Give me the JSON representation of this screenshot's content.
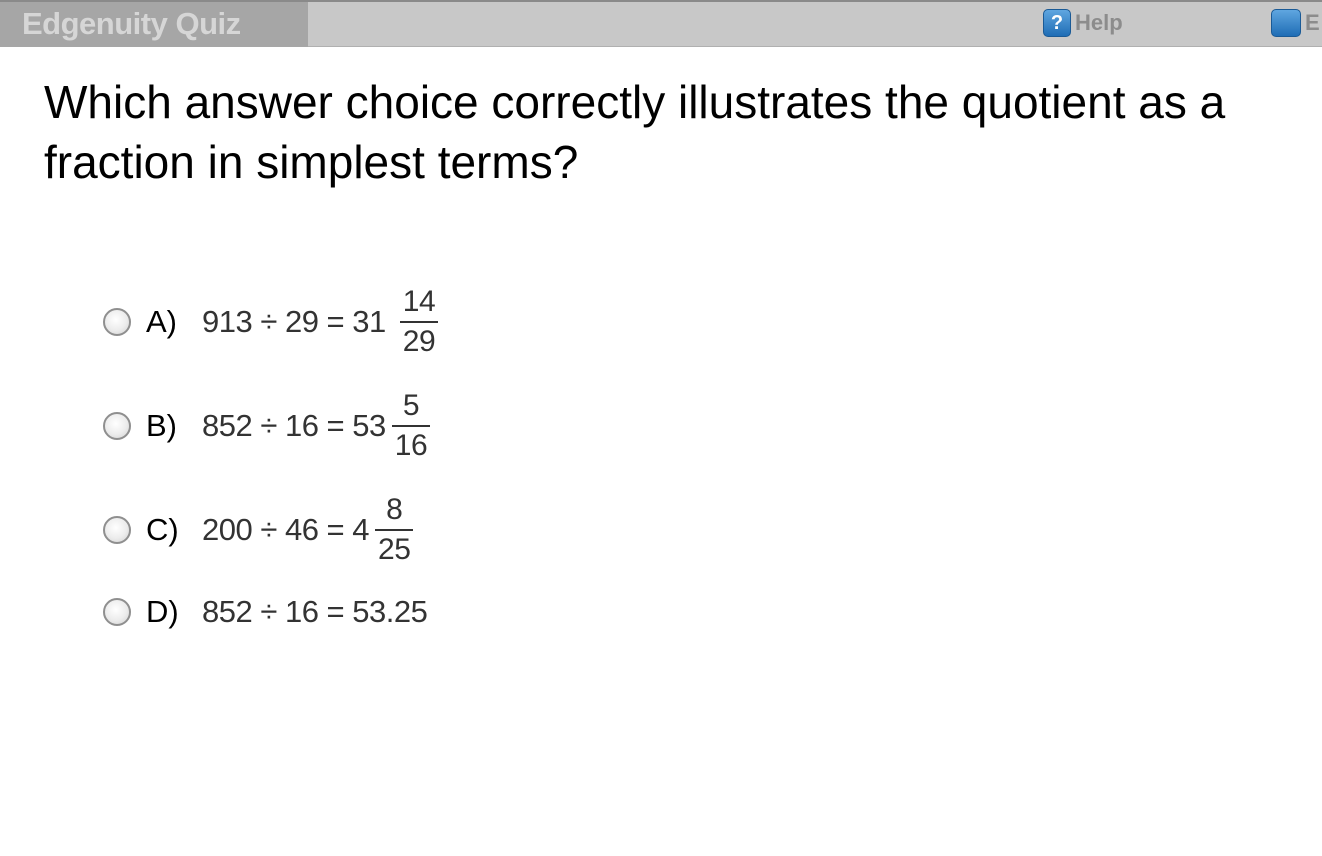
{
  "header": {
    "app_title": "Edgenuity Quiz",
    "help_label": "Help",
    "extra_label": "E",
    "icons": {
      "help": "help-icon",
      "extra": "blue-square-icon"
    }
  },
  "question": {
    "text": "Which answer choice correctly illustrates the quotient as a fraction in simplest terms?"
  },
  "choices": [
    {
      "letter": "A)",
      "expression": "913 ÷ 29 = 31",
      "frac_num": "14",
      "frac_den": "29"
    },
    {
      "letter": "B)",
      "expression": "852 ÷ 16 = 53",
      "frac_num": "5",
      "frac_den": "16"
    },
    {
      "letter": "C)",
      "expression": "200 ÷ 46 = 4",
      "frac_num": "8",
      "frac_den": "25"
    },
    {
      "letter": "D)",
      "expression": "852 ÷ 16 = 53.25"
    }
  ],
  "colors": {
    "header_bg": "#c8c8c8",
    "title_box_bg": "#a6a6a6",
    "icon_blue": "#2f80c8"
  }
}
